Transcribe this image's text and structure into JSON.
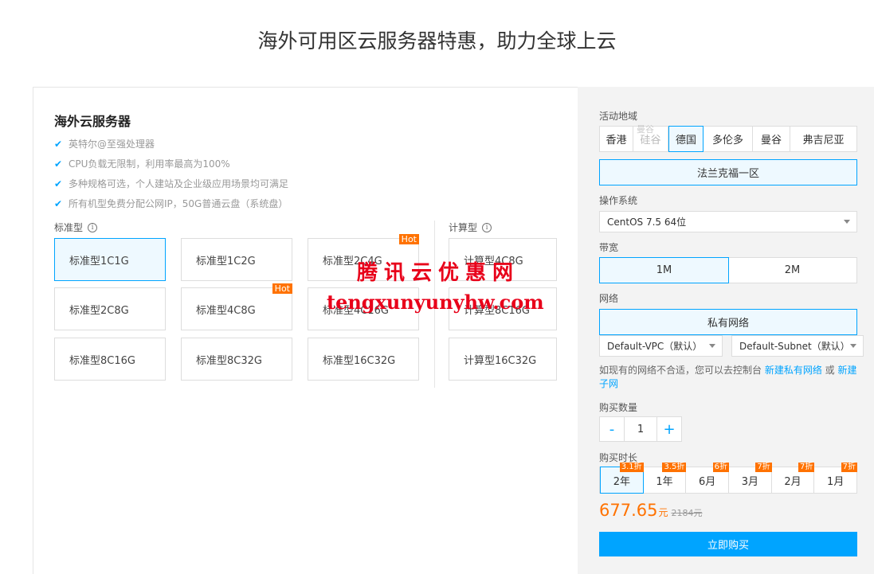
{
  "page": {
    "title": "海外可用区云服务器特惠，助力全球上云"
  },
  "left": {
    "title": "海外云服务器",
    "features": [
      "英特尔@至强处理器",
      "CPU负载无限制，利用率最高为100%",
      "多种规格可选，个人建站及企业级应用场景均可满足",
      "所有机型免费分配公网IP，50G普通云盘（系统盘）"
    ],
    "standard_label": "标准型",
    "compute_label": "计算型",
    "hot_label": "Hot",
    "standard_specs": [
      "标准型1C1G",
      "标准型1C2G",
      "标准型2C4G",
      "标准型2C8G",
      "标准型4C8G",
      "标准型4C16G",
      "标准型8C16G",
      "标准型8C32G",
      "标准型16C32G"
    ],
    "compute_specs": [
      "计算型4C8G",
      "计算型8C16G",
      "计算型16C32G"
    ],
    "selected_spec": "标准型1C1G"
  },
  "right": {
    "region_label": "活动地域",
    "regions": [
      "香港",
      "硅谷",
      "德国",
      "多伦多",
      "曼谷",
      "弗吉尼亚"
    ],
    "region_ghost": "曼谷",
    "selected_region": "德国",
    "zone": "法兰克福一区",
    "os_label": "操作系统",
    "os_value": "CentOS 7.5 64位",
    "bandwidth_label": "带宽",
    "bandwidth_options": [
      "1M",
      "2M"
    ],
    "selected_bandwidth": "1M",
    "network_label": "网络",
    "network_type": "私有网络",
    "vpc": "Default-VPC（默认）",
    "subnet": "Default-Subnet（默认）",
    "network_hint_prefix": "如现有的网络不合适，您可以去控制台 ",
    "network_link1": "新建私有网络",
    "network_hint_mid": " 或 ",
    "network_link2": "新建子网",
    "quantity_label": "购买数量",
    "quantity_minus": "-",
    "quantity_value": "1",
    "quantity_plus": "+",
    "duration_label": "购买时长",
    "durations": [
      {
        "label": "2年",
        "badge": "3.1折"
      },
      {
        "label": "1年",
        "badge": "3.5折"
      },
      {
        "label": "6月",
        "badge": "6折"
      },
      {
        "label": "3月",
        "badge": "7折"
      },
      {
        "label": "2月",
        "badge": "7折"
      },
      {
        "label": "1月",
        "badge": "7折"
      }
    ],
    "selected_duration": "2年",
    "price": "677.65",
    "price_unit": "元",
    "original_price": "2184元",
    "buy_label": "立即购买"
  },
  "watermark": {
    "cn": "腾讯云优惠网",
    "url": "tengxunyunyhw.com"
  },
  "colors": {
    "accent": "#00a4ff",
    "hot": "#ff7200",
    "watermark": "#e8001a"
  }
}
